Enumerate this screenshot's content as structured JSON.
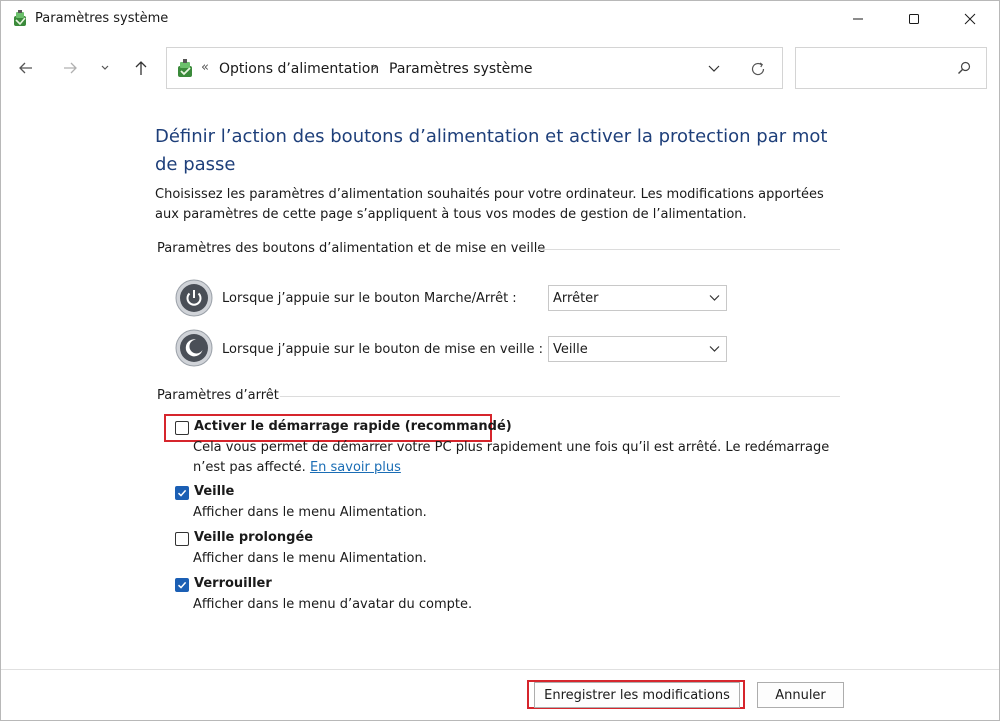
{
  "window": {
    "title": "Paramètres système"
  },
  "address_bar": {
    "separator_start": "«",
    "crumbs": [
      "Options d’alimentation",
      "Paramètres système"
    ],
    "separator": "›"
  },
  "search": {
    "placeholder": ""
  },
  "page": {
    "title": "Définir l’action des boutons d’alimentation et activer la protection par mot de passe",
    "description": "Choisissez les paramètres d’alimentation souhaités pour votre ordinateur. Les modifications apportées aux paramètres de cette page s’appliquent à tous vos modes de gestion de l’alimentation."
  },
  "power_buttons_section": {
    "heading": "Paramètres des boutons d’alimentation et de mise en veille",
    "rows": [
      {
        "label": "Lorsque j’appuie sur le bouton Marche/Arrêt :",
        "value": "Arrêter"
      },
      {
        "label": "Lorsque j’appuie sur le bouton de mise en veille :",
        "value": "Veille"
      }
    ]
  },
  "shutdown_section": {
    "heading": "Paramètres d’arrêt",
    "options": [
      {
        "label": "Activer le démarrage rapide (recommandé)",
        "checked": false,
        "description": "Cela vous permet de démarrer votre PC plus rapidement une fois qu’il est arrêté. Le redémarrage n’est pas affecté.",
        "link": "En savoir plus"
      },
      {
        "label": "Veille",
        "checked": true,
        "description": "Afficher dans le menu Alimentation."
      },
      {
        "label": "Veille prolongée",
        "checked": false,
        "description": "Afficher dans le menu Alimentation."
      },
      {
        "label": "Verrouiller",
        "checked": true,
        "description": "Afficher dans le menu d’avatar du compte."
      }
    ]
  },
  "footer": {
    "save_label": "Enregistrer les modifications",
    "cancel_label": "Annuler"
  },
  "colors": {
    "title_blue": "#1e3f7a",
    "link_blue": "#1a6db5",
    "checkbox_blue": "#1b5fb4",
    "highlight_red": "#d6252c"
  }
}
